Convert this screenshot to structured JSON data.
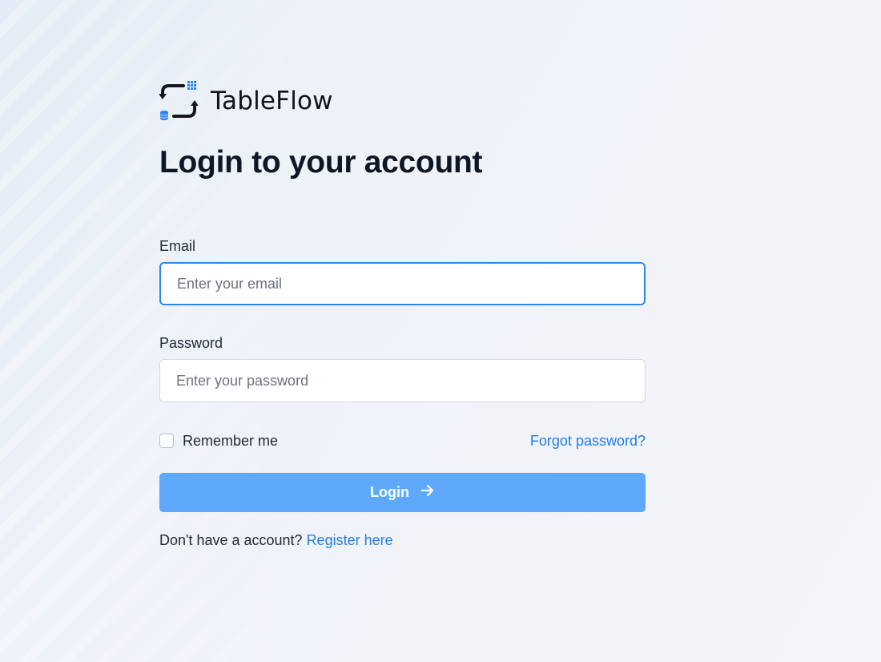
{
  "brand": {
    "name": "TableFlow",
    "logo_icon": "tableflow-sync-icon",
    "accent_color": "#1f7fe6"
  },
  "page": {
    "title": "Login to your account"
  },
  "form": {
    "email_label": "Email",
    "email_placeholder": "Enter your email",
    "email_value": "",
    "password_label": "Password",
    "password_placeholder": "Enter your password",
    "password_value": "",
    "remember_label": "Remember me",
    "remember_checked": false,
    "forgot_label": "Forgot password?",
    "login_label": "Login",
    "login_icon": "arrow-right-icon",
    "login_button_color": "#5ea9fb"
  },
  "footer": {
    "prompt": "Don't have a account?",
    "register_label": "Register here"
  }
}
